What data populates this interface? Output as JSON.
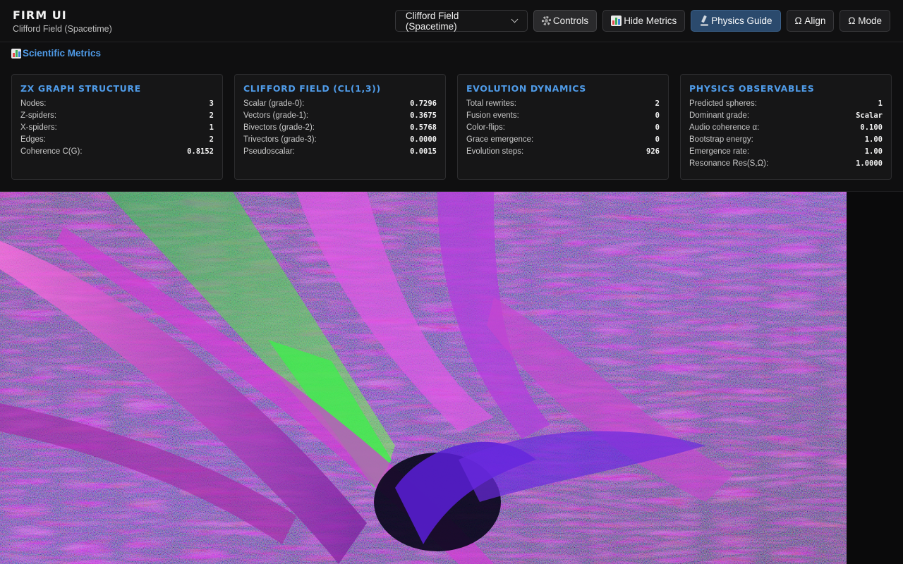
{
  "app": {
    "title": "FIRM UI",
    "subtitle": "Clifford Field (Spacetime)"
  },
  "toolbar": {
    "mode_select": {
      "selected": "Clifford Field (Spacetime)"
    },
    "controls_label": "Controls",
    "hide_metrics_label": "Hide Metrics",
    "physics_guide_label": "Physics Guide",
    "align_label": "Ω Align",
    "mode_label": "Ω Mode"
  },
  "metrics": {
    "heading": "Scientific Metrics",
    "cards": [
      {
        "title": "ZX GRAPH STRUCTURE",
        "rows": [
          {
            "label": "Nodes:",
            "value": "3"
          },
          {
            "label": "Z-spiders:",
            "value": "2"
          },
          {
            "label": "X-spiders:",
            "value": "1"
          },
          {
            "label": "Edges:",
            "value": "2"
          },
          {
            "label": "Coherence C(G):",
            "value": "0.8152"
          }
        ]
      },
      {
        "title": "CLIFFORD FIELD (CL(1,3))",
        "rows": [
          {
            "label": "Scalar (grade-0):",
            "value": "0.7296"
          },
          {
            "label": "Vectors (grade-1):",
            "value": "0.3675"
          },
          {
            "label": "Bivectors (grade-2):",
            "value": "0.5768"
          },
          {
            "label": "Trivectors (grade-3):",
            "value": "0.0000"
          },
          {
            "label": "Pseudoscalar:",
            "value": "0.0015"
          }
        ]
      },
      {
        "title": "EVOLUTION DYNAMICS",
        "rows": [
          {
            "label": "Total rewrites:",
            "value": "2"
          },
          {
            "label": "Fusion events:",
            "value": "0"
          },
          {
            "label": "Color-flips:",
            "value": "0"
          },
          {
            "label": "Grace emergence:",
            "value": "0"
          },
          {
            "label": "Evolution steps:",
            "value": "926"
          }
        ]
      },
      {
        "title": "PHYSICS OBSERVABLES",
        "rows": [
          {
            "label": "Predicted spheres:",
            "value": "1"
          },
          {
            "label": "Dominant grade:",
            "value": "Scalar"
          },
          {
            "label": "Audio coherence α:",
            "value": "0.100"
          },
          {
            "label": "Bootstrap energy:",
            "value": "1.00"
          },
          {
            "label": "Emergence rate:",
            "value": "1.00"
          },
          {
            "label": "Resonance Res(S,Ω):",
            "value": "1.0000"
          }
        ]
      }
    ]
  },
  "colors": {
    "accent": "#4f9be8",
    "active_button": "#2b4a6d",
    "visual_magenta": "#e04ad8",
    "visual_violet": "#5a2bd6",
    "visual_green": "#39e04a"
  }
}
